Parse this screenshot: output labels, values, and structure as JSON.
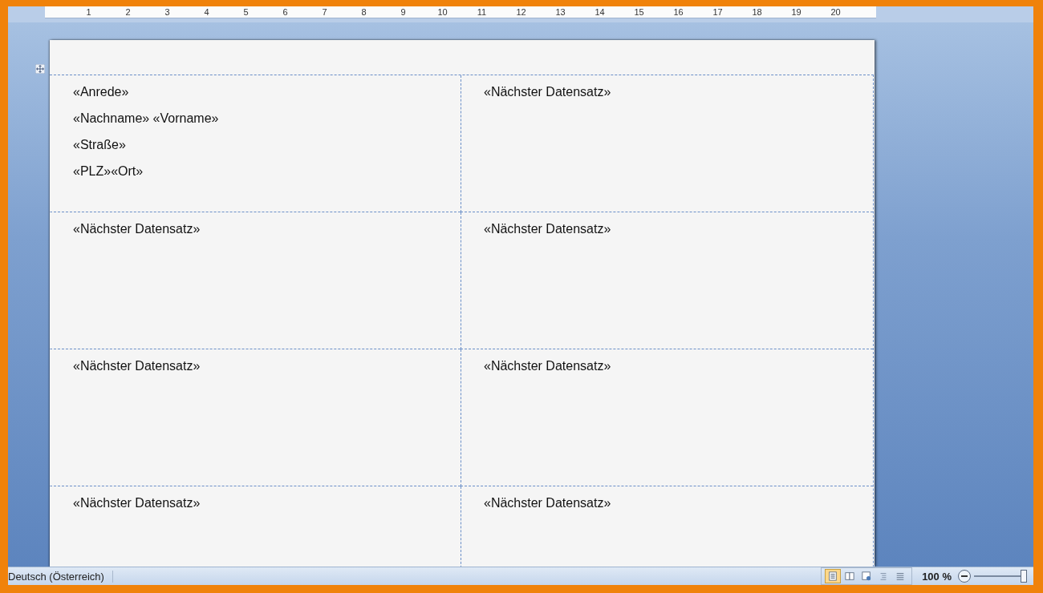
{
  "ruler": {
    "labels": [
      "1",
      "2",
      "3",
      "4",
      "5",
      "6",
      "7",
      "8",
      "9",
      "10",
      "11",
      "12",
      "13",
      "14",
      "15",
      "16",
      "17",
      "18",
      "19",
      "20"
    ]
  },
  "labels": [
    {
      "lines": [
        "«Anrede»",
        "«Nachname» «Vorname»",
        "«Straße»",
        "«PLZ»«Ort»"
      ]
    },
    {
      "lines": [
        "«Nächster Datensatz»"
      ]
    },
    {
      "lines": [
        "«Nächster Datensatz»"
      ]
    },
    {
      "lines": [
        "«Nächster Datensatz»"
      ]
    },
    {
      "lines": [
        "«Nächster Datensatz»"
      ]
    },
    {
      "lines": [
        "«Nächster Datensatz»"
      ]
    },
    {
      "lines": [
        "«Nächster Datensatz»"
      ]
    },
    {
      "lines": [
        "«Nächster Datensatz»"
      ]
    }
  ],
  "status_bar": {
    "language": "Deutsch (Österreich)",
    "views": [
      {
        "kind": "print-layout",
        "selected": true
      },
      {
        "kind": "reading",
        "selected": false
      },
      {
        "kind": "web-layout",
        "selected": false
      },
      {
        "kind": "outline",
        "selected": false
      },
      {
        "kind": "draft",
        "selected": false
      }
    ],
    "zoom": "100 %",
    "zoom_slider": {
      "level": 1
    }
  }
}
